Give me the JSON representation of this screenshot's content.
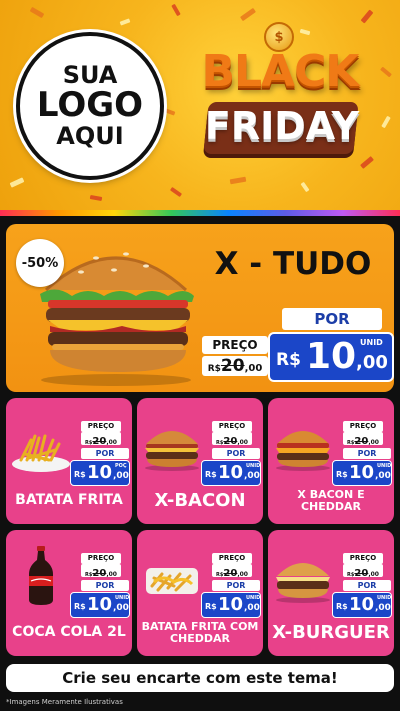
{
  "colors": {
    "card_pink": "#e8418a",
    "feature_orange": "#f7a21b",
    "price_blue": "#1b46c8",
    "header_yellow": "#f7b51d"
  },
  "header": {
    "logo": {
      "line1": "SUA",
      "line2": "LOGO",
      "line3": "AQUI"
    },
    "banner": {
      "coin": "$",
      "line1": "BLACK",
      "line2": "FRIDAY"
    }
  },
  "feature": {
    "discount": "-50%",
    "name": "X - TUDO",
    "preco_label": "PREÇO",
    "old_currency": "R$",
    "old_value": "20",
    "old_cents": ",00",
    "por_label": "POR",
    "new_currency": "R$",
    "new_value": "10",
    "new_cents": ",00",
    "unit": "UNID",
    "image_icon": "burger-icon"
  },
  "products": [
    {
      "name": "BATATA FRITA",
      "icon": "fries-icon",
      "preco_label": "PREÇO",
      "old_currency": "R$",
      "old_value": "20",
      "old_cents": ",00",
      "por_label": "POR",
      "new_currency": "R$",
      "new_value": "10",
      "new_cents": ",00",
      "unit": "POÇ"
    },
    {
      "name": "X-BACON",
      "icon": "burger-icon",
      "preco_label": "PREÇO",
      "old_currency": "R$",
      "old_value": "20",
      "old_cents": ",00",
      "por_label": "POR",
      "new_currency": "R$",
      "new_value": "10",
      "new_cents": ",00",
      "unit": "UNID"
    },
    {
      "name": "X BACON E CHEDDAR",
      "icon": "cheese-burger-icon",
      "preco_label": "PREÇO",
      "old_currency": "R$",
      "old_value": "20",
      "old_cents": ",00",
      "por_label": "POR",
      "new_currency": "R$",
      "new_value": "10",
      "new_cents": ",00",
      "unit": "UNID"
    },
    {
      "name": "COCA COLA 2L",
      "icon": "soda-bottle-icon",
      "preco_label": "PREÇO",
      "old_currency": "R$",
      "old_value": "20",
      "old_cents": ",00",
      "por_label": "POR",
      "new_currency": "R$",
      "new_value": "10",
      "new_cents": ",00",
      "unit": "UNID"
    },
    {
      "name": "BATATA FRITA COM CHEDDAR",
      "icon": "cheddar-fries-icon",
      "preco_label": "PREÇO",
      "old_currency": "R$",
      "old_value": "20",
      "old_cents": ",00",
      "por_label": "POR",
      "new_currency": "R$",
      "new_value": "10",
      "new_cents": ",00",
      "unit": "UNID"
    },
    {
      "name": "X-BURGUER",
      "icon": "burger-icon",
      "preco_label": "PREÇO",
      "old_currency": "R$",
      "old_value": "20",
      "old_cents": ",00",
      "por_label": "POR",
      "new_currency": "R$",
      "new_value": "10",
      "new_cents": ",00",
      "unit": "UNID"
    }
  ],
  "footer": {
    "cta": "Crie seu encarte com este tema!",
    "disclaimer": "*Imagens Meramente Ilustrativas"
  }
}
